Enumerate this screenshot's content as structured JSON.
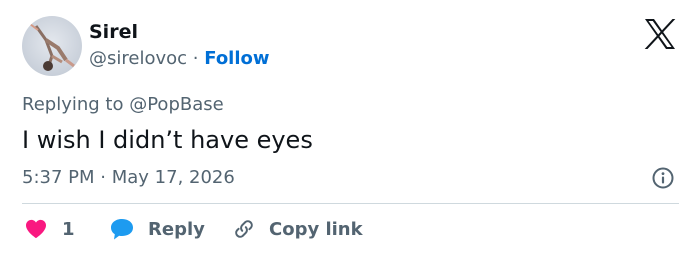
{
  "user": {
    "display_name": "Sirel",
    "handle": "@sirelovoc",
    "separator": "·",
    "follow_label": "Follow"
  },
  "tweet": {
    "reply_prefix": "Replying to",
    "reply_handle": "@PopBase",
    "text": "I wish I didn’t have eyes",
    "time": "5:37 PM",
    "date": "May 17, 2026"
  },
  "actions": {
    "like_count": "1",
    "reply_label": "Reply",
    "copy_label": "Copy link"
  },
  "icons": {
    "logo": "x-logo-icon",
    "info": "info-icon",
    "like": "heart-icon",
    "reply": "speech-bubble-icon",
    "copy": "link-icon"
  },
  "colors": {
    "like": "#f91880",
    "reply": "#1d9bf0",
    "follow": "#006fd6",
    "muted": "#536471",
    "text": "#0f1419"
  }
}
